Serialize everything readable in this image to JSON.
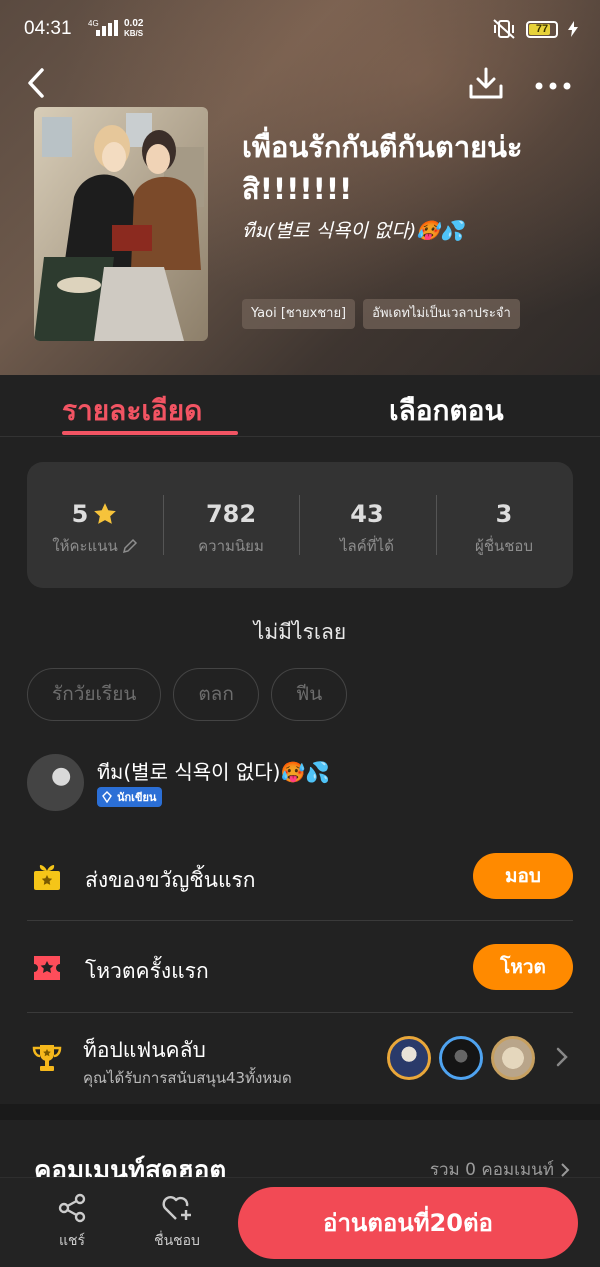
{
  "status_bar": {
    "time": "04:31",
    "network": "4G",
    "speed_top": "0.02",
    "speed_unit": "KB/S",
    "battery": "77"
  },
  "header": {
    "back_icon": "chevron-left-icon",
    "download_icon": "download-icon",
    "more_icon": "more-horizontal-icon"
  },
  "book": {
    "title": "เพื่อนรักกันตีกันตายน่ะสิ!!!!!!!",
    "author": "ทีม(별로 식욕이 없다)🥵💦",
    "tags": [
      "Yaoi [ชายxชาย]",
      "อัพเดทไม่เป็นเวลาประจำ"
    ]
  },
  "tabs": {
    "detail": "รายละเอียด",
    "episodes": "เลือกตอน"
  },
  "stats": [
    {
      "value": "5",
      "label": "ให้คะแนน",
      "icon": "star-icon"
    },
    {
      "value": "782",
      "label": "ความนิยม"
    },
    {
      "value": "43",
      "label": "ไลค์ที่ได้"
    },
    {
      "value": "3",
      "label": "ผู้ชื่นชอบ"
    }
  ],
  "description": "ไม่มีไรเลย",
  "genres": [
    "รักวัยเรียน",
    "ตลก",
    "ฟีน"
  ],
  "author_card": {
    "name": "ทีม(별로 식욕이 없다)🥵💦",
    "badge": "นักเขียน"
  },
  "actions": {
    "gift_label": "ส่งของขวัญชิ้นแรก",
    "gift_button": "มอบ",
    "vote_label": "โหวตครั้งแรก",
    "vote_button": "โหวต",
    "fanclub_label": "ท็อปแฟนคลับ",
    "fanclub_sub": "คุณได้รับการสนับสนุน43ทั้งหมด"
  },
  "comments": {
    "title": "คอมเมนท์สุดฮอต",
    "count": "รวม 0 คอมเมนท์"
  },
  "bottom": {
    "share": "แชร์",
    "like": "ชื่นชอบ",
    "read": "อ่านตอนที่20ต่อ"
  },
  "colors": {
    "accent_red": "#f25463",
    "orange": "#ff8a00",
    "read_button": "#f24a55",
    "gift_yellow": "#f5c518"
  }
}
